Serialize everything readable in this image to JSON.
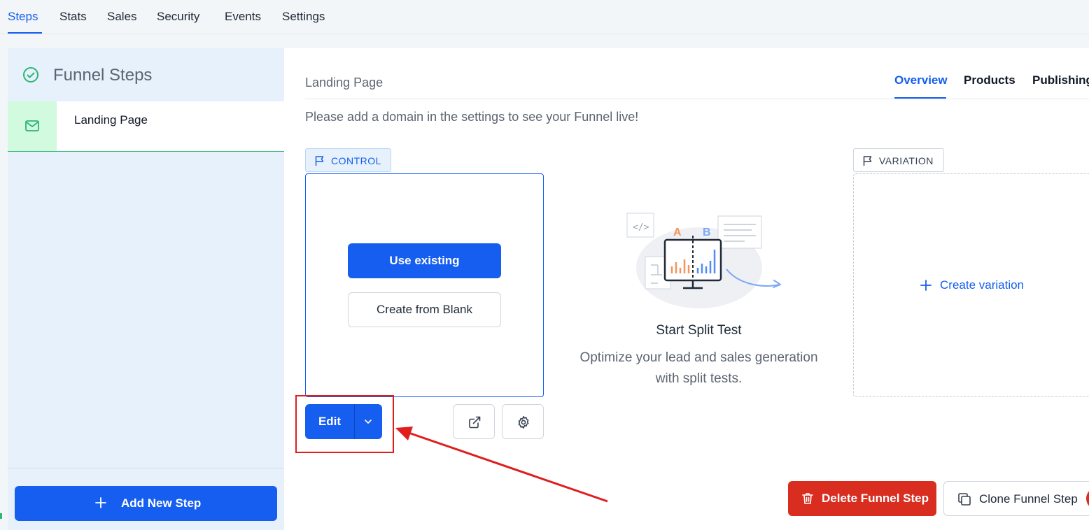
{
  "topnav": {
    "tabs": [
      {
        "label": "Steps",
        "active": true
      },
      {
        "label": "Stats"
      },
      {
        "label": "Sales"
      },
      {
        "label": "Security"
      },
      {
        "label": "Events"
      },
      {
        "label": "Settings"
      }
    ]
  },
  "sidebar": {
    "title": "Funnel Steps",
    "steps": [
      {
        "label": "Landing Page",
        "icon": "mail-icon"
      }
    ],
    "add_button": "Add New Step"
  },
  "main": {
    "breadcrumb": "Landing Page",
    "tabs": [
      {
        "label": "Overview",
        "active": true
      },
      {
        "label": "Products"
      },
      {
        "label": "Publishing"
      }
    ],
    "notice": "Please add a domain in the settings to see your Funnel live!",
    "control": {
      "label": "CONTROL",
      "use_existing": "Use existing",
      "create_blank": "Create from Blank",
      "edit": "Edit"
    },
    "split_test": {
      "title": "Start Split Test",
      "description": "Optimize your lead and sales generation with split tests.",
      "label_a": "A",
      "label_b": "B"
    },
    "variation": {
      "label": "VARIATION",
      "create": "Create variation"
    },
    "delete_button": "Delete Funnel Step",
    "clone_button": "Clone Funnel Step"
  },
  "colors": {
    "primary": "#155eef",
    "danger": "#d92d20",
    "success": "#2bb673",
    "annotation": "#e01e1e"
  }
}
